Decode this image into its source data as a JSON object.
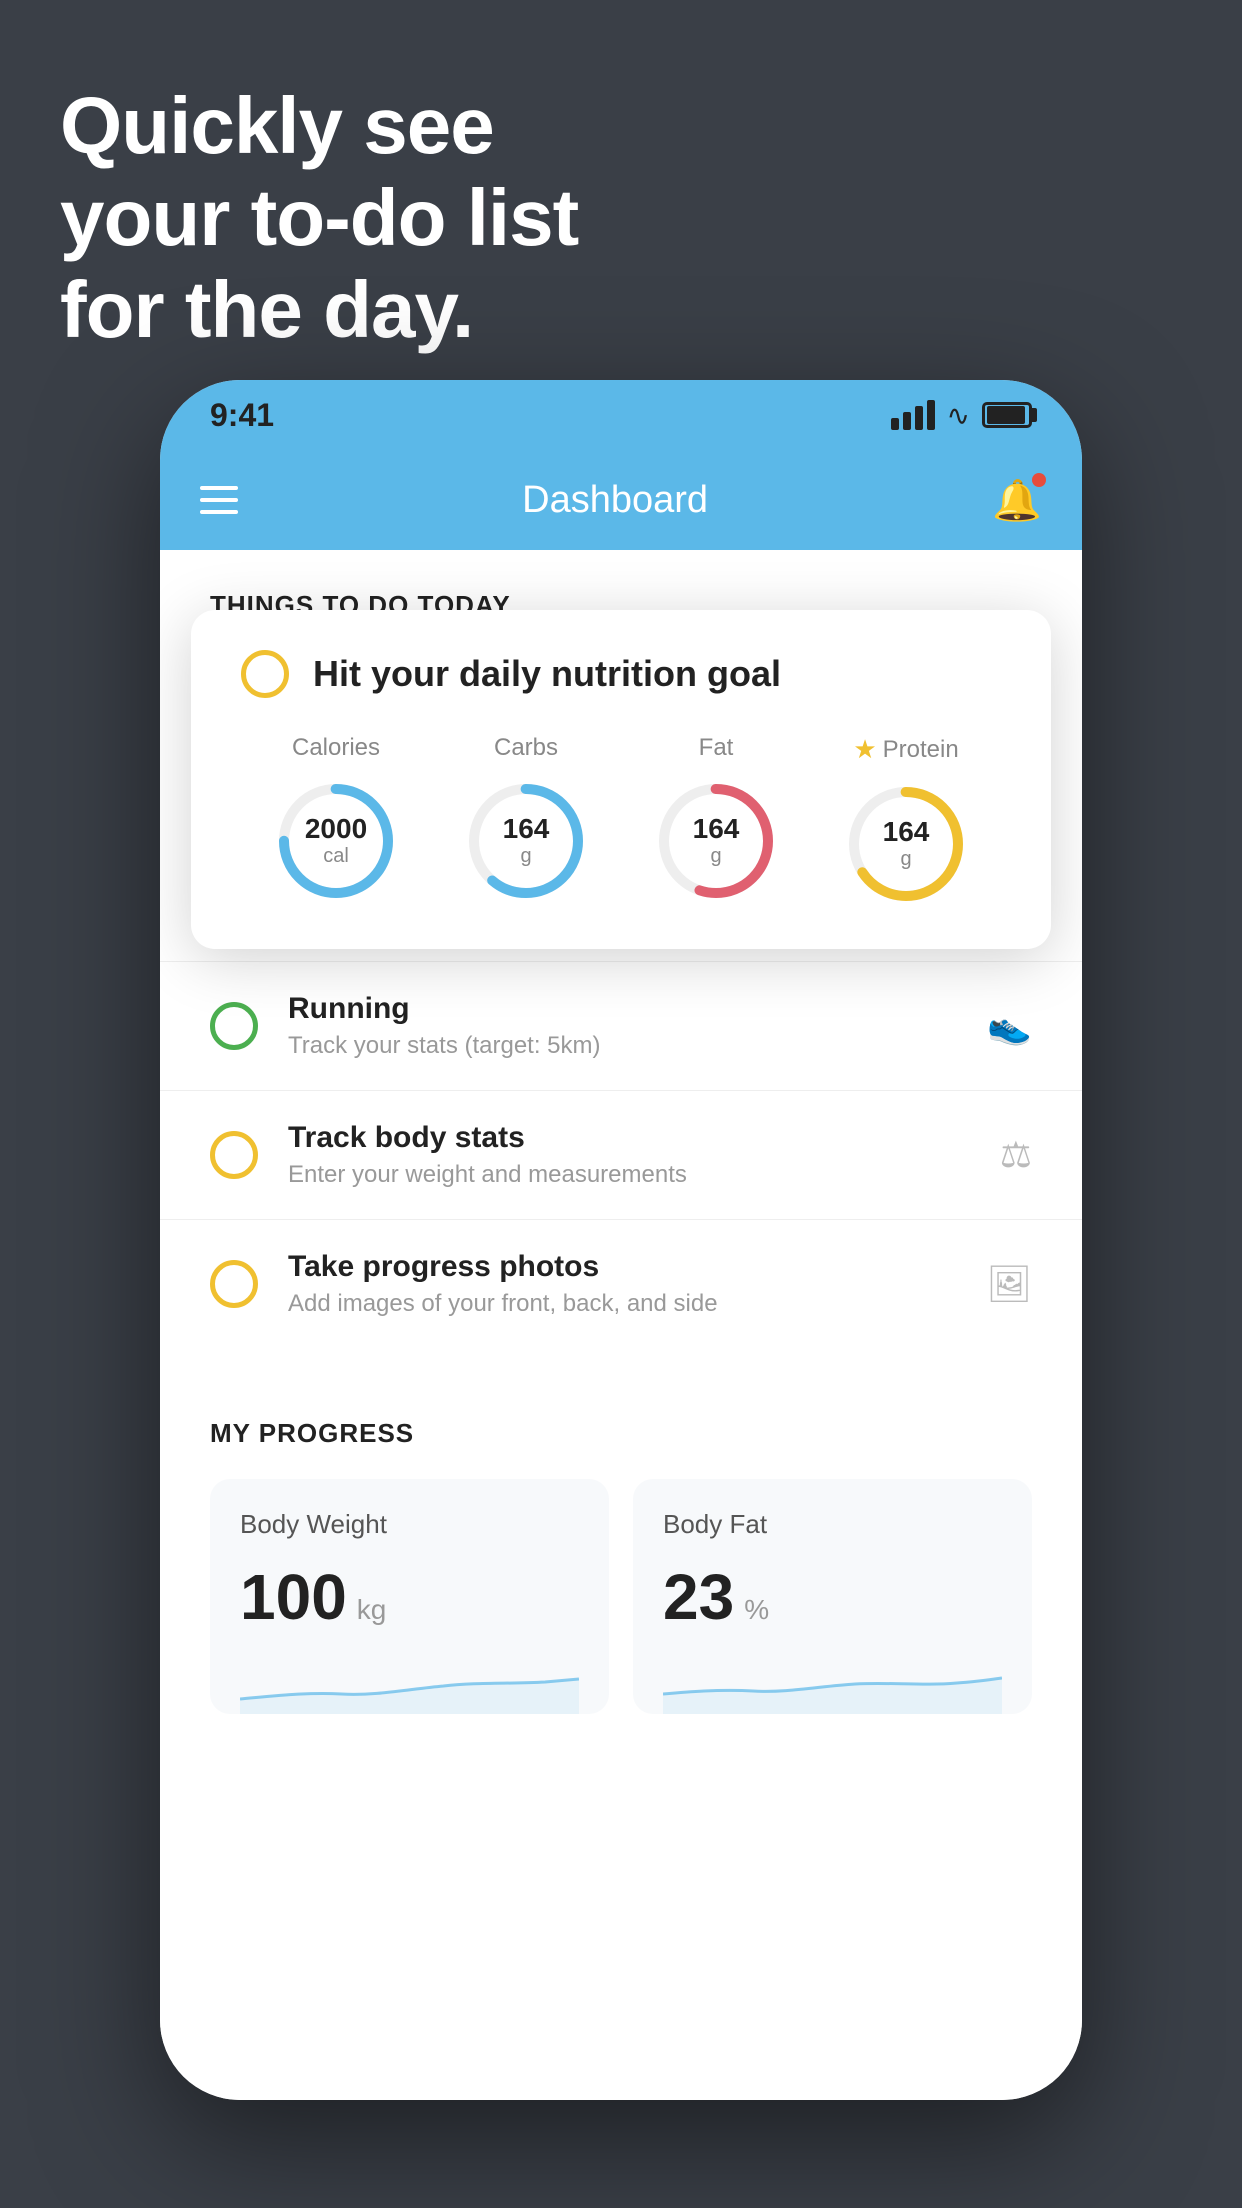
{
  "background": {
    "headline_line1": "Quickly see",
    "headline_line2": "your to-do list",
    "headline_line3": "for the day."
  },
  "status_bar": {
    "time": "9:41"
  },
  "header": {
    "title": "Dashboard"
  },
  "things_section": {
    "title": "THINGS TO DO TODAY"
  },
  "floating_card": {
    "title": "Hit your daily nutrition goal",
    "nutrition": [
      {
        "label": "Calories",
        "value": "2000",
        "unit": "cal",
        "type": "cal",
        "star": false
      },
      {
        "label": "Carbs",
        "value": "164",
        "unit": "g",
        "type": "carb",
        "star": false
      },
      {
        "label": "Fat",
        "value": "164",
        "unit": "g",
        "type": "fat",
        "star": false
      },
      {
        "label": "Protein",
        "value": "164",
        "unit": "g",
        "type": "protein",
        "star": true
      }
    ]
  },
  "todo_items": [
    {
      "title": "Running",
      "subtitle": "Track your stats (target: 5km)",
      "circle": "green",
      "icon": "👟"
    },
    {
      "title": "Track body stats",
      "subtitle": "Enter your weight and measurements",
      "circle": "yellow",
      "icon": "⚖"
    },
    {
      "title": "Take progress photos",
      "subtitle": "Add images of your front, back, and side",
      "circle": "yellow",
      "icon": "🖼"
    }
  ],
  "progress_section": {
    "title": "MY PROGRESS",
    "cards": [
      {
        "title": "Body Weight",
        "value": "100",
        "unit": "kg"
      },
      {
        "title": "Body Fat",
        "value": "23",
        "unit": "%"
      }
    ]
  }
}
